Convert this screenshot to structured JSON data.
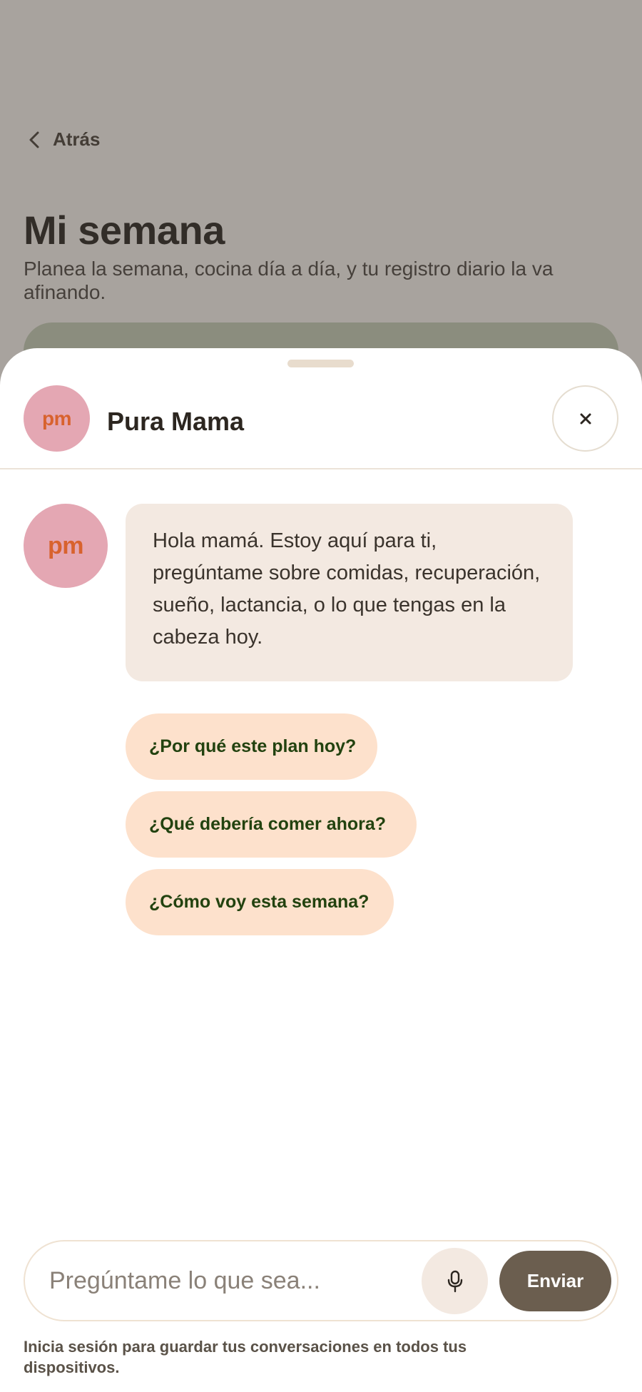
{
  "background_page": {
    "back_label": "Atrás",
    "title": "Mi semana",
    "subtitle": "Planea la semana, cocina día a día, y tu registro diario la va afinando."
  },
  "assistant": {
    "avatar_initials": "pm",
    "name": "Pura Mama",
    "close_icon": "close-icon"
  },
  "conversation": {
    "avatar_initials": "pm",
    "greeting": "Hola mamá. Estoy aquí para ti, pregúntame sobre comidas, recuperación, sueño, lactancia, o lo que tengas en la cabeza hoy.",
    "suggestions": [
      "¿Por qué este plan hoy?",
      "¿Qué debería comer ahora?",
      "¿Cómo voy esta semana?"
    ]
  },
  "composer": {
    "placeholder": "Pregúntame lo que sea...",
    "mic_icon": "microphone-icon",
    "send_label": "Enviar"
  },
  "footer_note": "Inicia sesión para guardar tus conversaciones en todos tus dispositivos.",
  "colors": {
    "avatar_bg": "#e4a7b3",
    "avatar_text": "#d8622e",
    "bubble_bg": "#f3e9e1",
    "chip_bg": "#fde1cc",
    "chip_text": "#22420f",
    "send_button": "#6b5e4f"
  }
}
